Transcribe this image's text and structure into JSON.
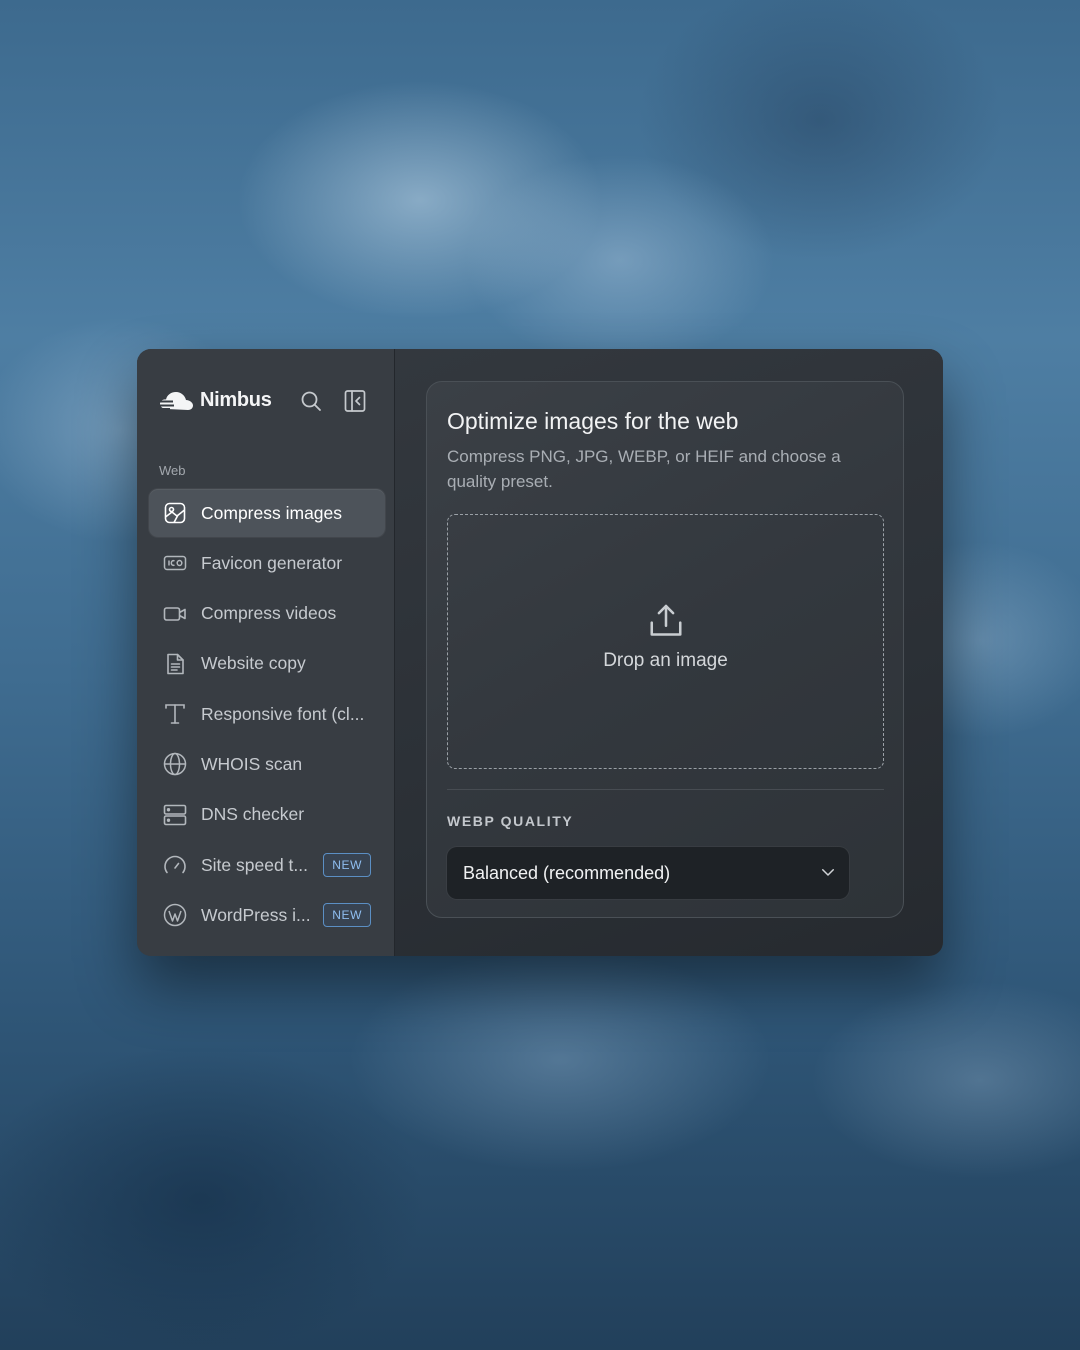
{
  "app": {
    "name": "Nimbus",
    "search_icon": "search-icon",
    "sidebar_toggle_icon": "sidebar-collapse-icon"
  },
  "sidebar": {
    "section_label": "Web",
    "items": [
      {
        "label": "Compress images",
        "icon": "image-icon",
        "active": true
      },
      {
        "label": "Favicon generator",
        "icon": "ico-file-icon"
      },
      {
        "label": "Compress videos",
        "icon": "video-camera-icon"
      },
      {
        "label": "Website copy",
        "icon": "document-icon"
      },
      {
        "label": "Responsive font (cl...",
        "icon": "type-icon"
      },
      {
        "label": "WHOIS scan",
        "icon": "globe-icon"
      },
      {
        "label": "DNS checker",
        "icon": "server-icon"
      },
      {
        "label": "Site speed t...",
        "icon": "gauge-icon",
        "badge": "NEW"
      },
      {
        "label": "WordPress i...",
        "icon": "wordpress-icon",
        "badge": "NEW"
      }
    ]
  },
  "main": {
    "title": "Optimize images for the web",
    "subtitle": "Compress PNG, JPG, WEBP, or HEIF and choose a quality preset.",
    "dropzone": {
      "label": "Drop an image",
      "icon": "upload-icon"
    },
    "quality": {
      "label": "WEBP QUALITY",
      "selected": "Balanced (recommended)"
    }
  },
  "colors": {
    "accent_badge": "#8fbef0",
    "window_bg": "#2c3137",
    "sidebar_bg": "#383d43"
  }
}
